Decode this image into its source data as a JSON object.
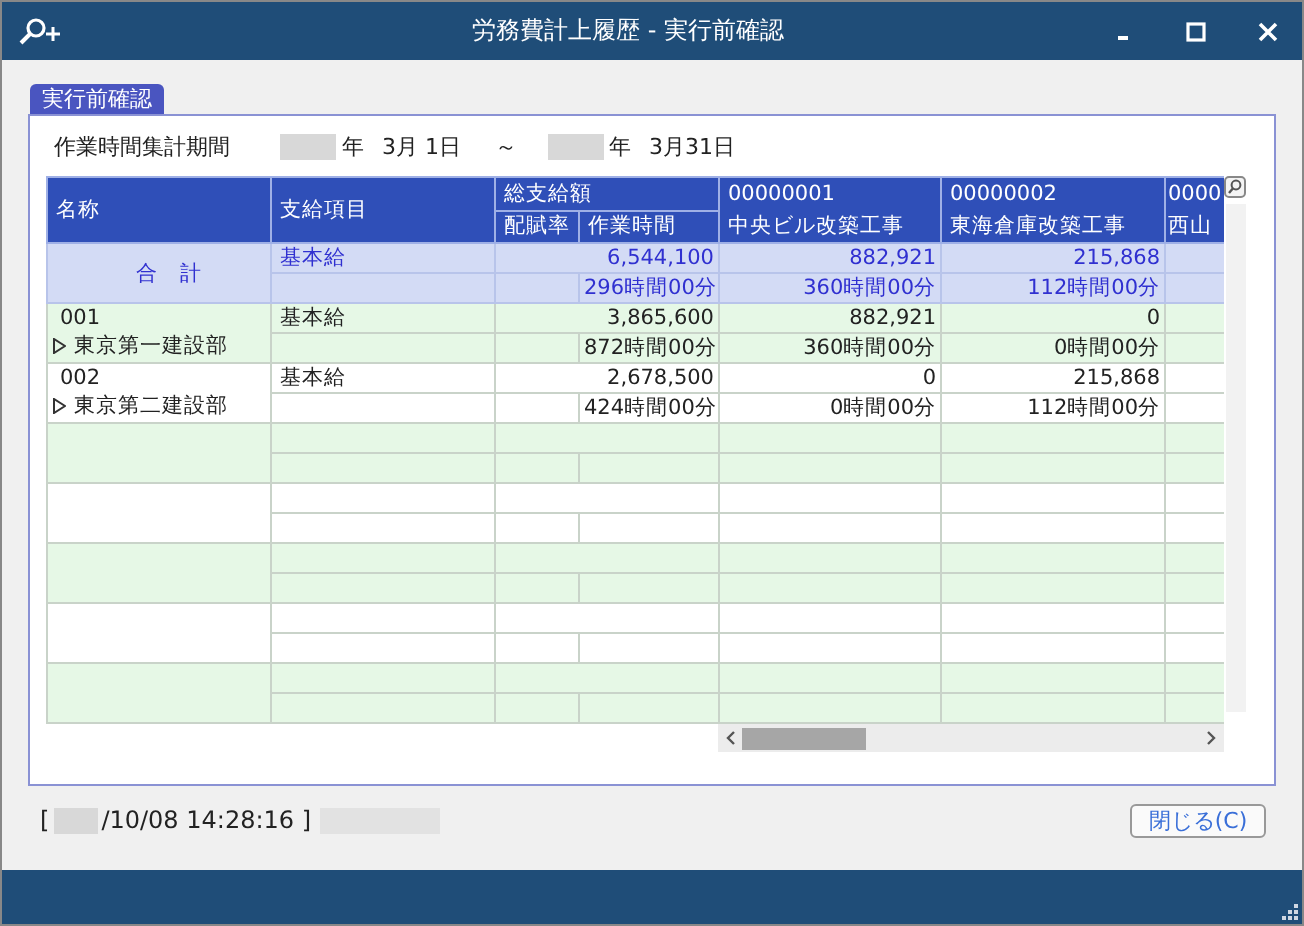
{
  "window": {
    "title": "労務費計上履歴 - 実行前確認"
  },
  "tab": {
    "label": "実行前確認",
    "selected": true
  },
  "period": {
    "label": "作業時間集計期間",
    "from_year_suffix": "年",
    "from_date": "3月 1日",
    "separator": "～",
    "to_year_suffix": "年",
    "to_date": "3月31日"
  },
  "table": {
    "headers": {
      "name": "名称",
      "item": "支給項目",
      "total": "総支給額",
      "rate": "配賦率",
      "hours": "作業時間"
    },
    "projects": [
      {
        "code": "00000001",
        "name": "中央ビル改築工事"
      },
      {
        "code": "00000002",
        "name": "東海倉庫改築工事"
      },
      {
        "code": "0000",
        "name": "西山"
      }
    ],
    "rows": [
      {
        "kind": "total",
        "name": "合　計",
        "item": "基本給",
        "amount": "6,544,100",
        "hours": "296時間00分",
        "projects": [
          {
            "amount": "882,921",
            "hours": "360時間00分"
          },
          {
            "amount": "215,868",
            "hours": "112時間00分"
          }
        ]
      },
      {
        "kind": "group",
        "code": "001",
        "name": "東京第一建設部",
        "expanded": false,
        "item": "基本給",
        "amount": "3,865,600",
        "hours": "872時間00分",
        "projects": [
          {
            "amount": "882,921",
            "hours": "360時間00分"
          },
          {
            "amount": "0",
            "hours": "0時間00分"
          }
        ]
      },
      {
        "kind": "group",
        "code": "002",
        "name": "東京第二建設部",
        "expanded": false,
        "item": "基本給",
        "amount": "2,678,500",
        "hours": "424時間00分",
        "projects": [
          {
            "amount": "0",
            "hours": "0時間00分"
          },
          {
            "amount": "215,868",
            "hours": "112時間00分"
          }
        ]
      },
      {
        "kind": "blank"
      },
      {
        "kind": "blank"
      },
      {
        "kind": "blank"
      },
      {
        "kind": "blank"
      },
      {
        "kind": "blank"
      }
    ]
  },
  "footer": {
    "open_bracket": "[",
    "timestamp": "/10/08 14:28:16 ]",
    "close_button": "閉じる(C)"
  }
}
